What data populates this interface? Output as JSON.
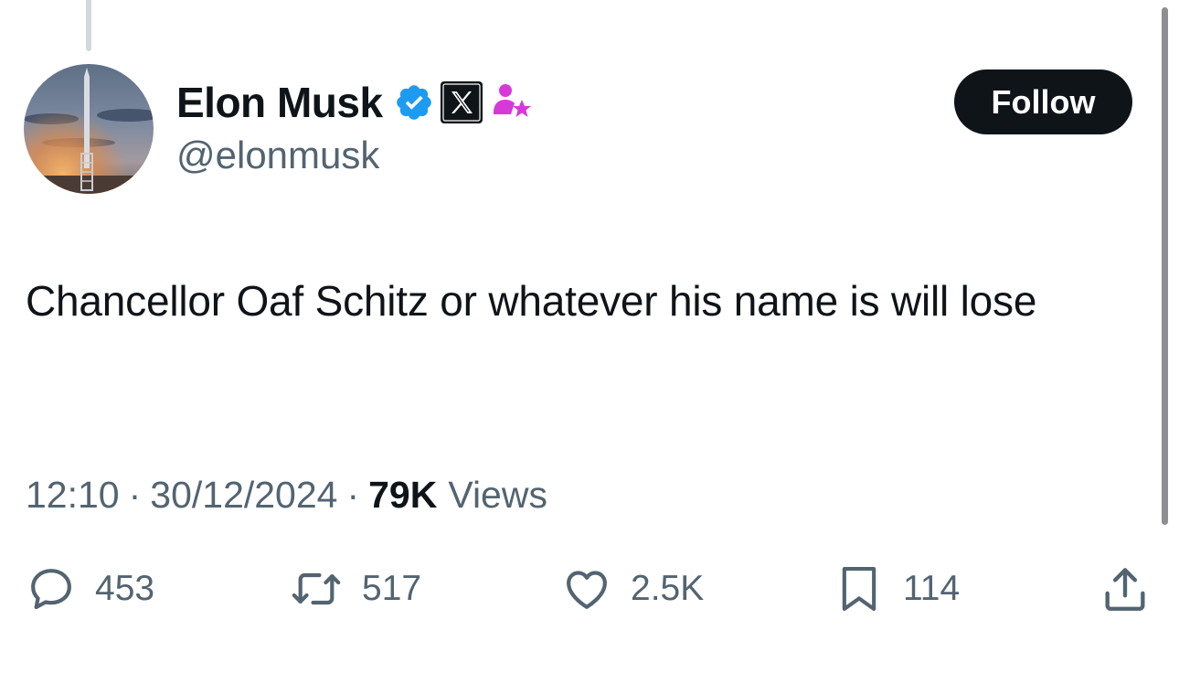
{
  "author": {
    "display_name": "Elon Musk",
    "handle": "@elonmusk",
    "verified_badge": "verified-check-icon",
    "affiliate_badge": "x-logo-icon",
    "extra_badge": "user-star-icon"
  },
  "follow_button": {
    "label": "Follow"
  },
  "tweet": {
    "text": "Chancellor Oaf Schitz or whatever his name is will lose"
  },
  "meta": {
    "time": "12:10",
    "separator": "·",
    "date": "30/12/2024",
    "views_count": "79K",
    "views_label": "Views"
  },
  "actions": {
    "replies": "453",
    "reposts": "517",
    "likes": "2.5K",
    "bookmarks": "114"
  },
  "colors": {
    "text_primary": "#0f1419",
    "text_secondary": "#536471",
    "verified_blue": "#1d9bf0",
    "affiliate_pink": "#d63ad6",
    "follow_bg": "#0f1419"
  }
}
